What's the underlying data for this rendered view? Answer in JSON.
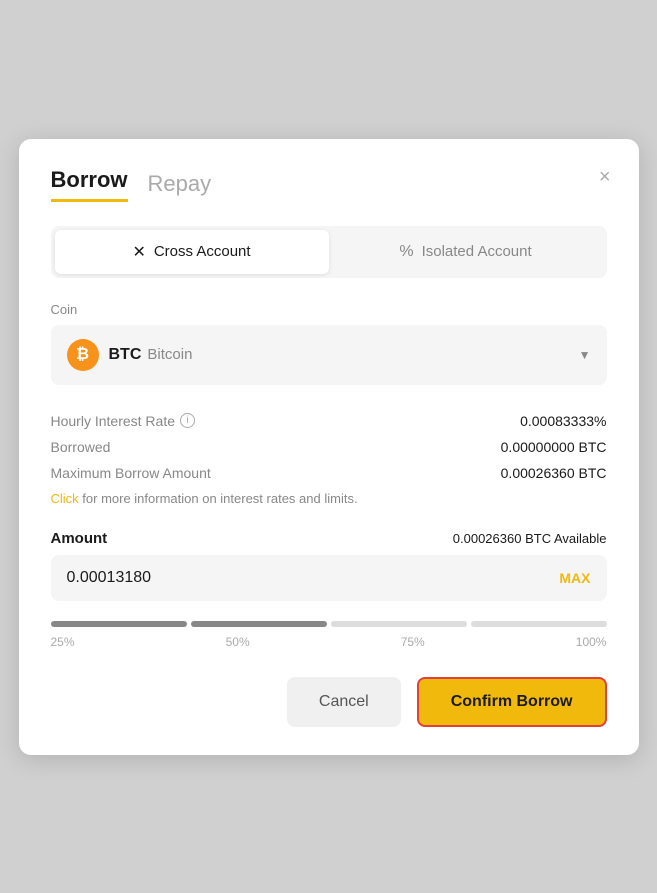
{
  "modal": {
    "title": "Borrow",
    "tab_borrow": "Borrow",
    "tab_repay": "Repay",
    "close_icon": "×"
  },
  "account_selector": {
    "cross_account_label": "Cross Account",
    "cross_account_icon": "✕",
    "isolated_account_label": "Isolated Account",
    "isolated_account_icon": "%"
  },
  "coin": {
    "label": "Coin",
    "symbol": "BTC",
    "name": "Bitcoin",
    "icon_letter": "₿"
  },
  "info": {
    "hourly_rate_label": "Hourly Interest Rate",
    "hourly_rate_value": "0.00083333%",
    "borrowed_label": "Borrowed",
    "borrowed_value": "0.00000000 BTC",
    "max_borrow_label": "Maximum Borrow Amount",
    "max_borrow_value": "0.00026360 BTC",
    "click_text": "Click",
    "click_suffix": " for more information on interest rates and limits."
  },
  "amount": {
    "label": "Amount",
    "available_value": "0.00026360",
    "available_currency": "BTC Available",
    "input_value": "0.00013180",
    "max_label": "MAX"
  },
  "slider": {
    "segments_filled": 2,
    "segments_empty": 2,
    "labels": [
      "25%",
      "50%",
      "75%",
      "100%"
    ]
  },
  "footer": {
    "cancel_label": "Cancel",
    "confirm_label": "Confirm Borrow"
  }
}
